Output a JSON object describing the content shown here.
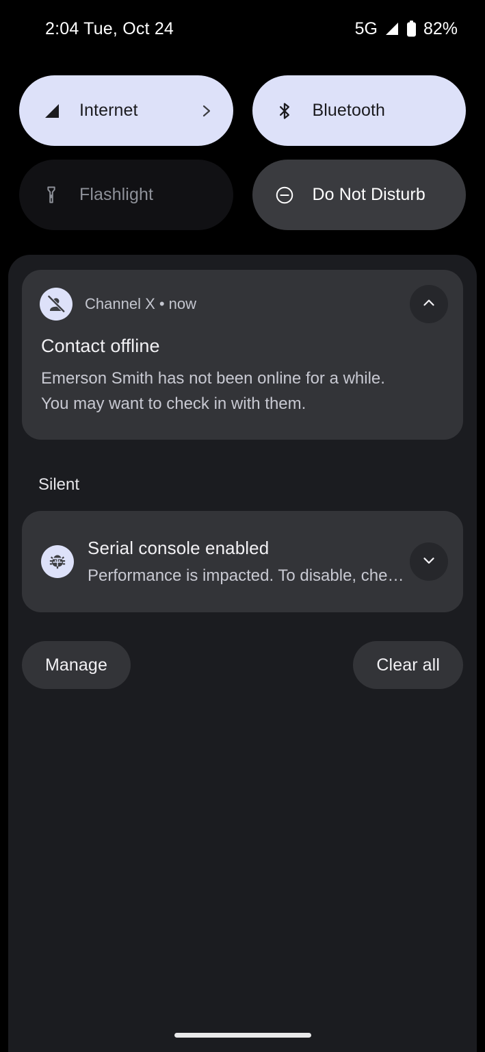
{
  "status_bar": {
    "time_date": "2:04 Tue, Oct 24",
    "network_type": "5G",
    "signal_icon": "signal-bars-icon",
    "battery_icon": "battery-icon",
    "battery_percent": "82%"
  },
  "quick_settings": {
    "tiles": [
      {
        "label": "Internet",
        "icon": "signal-bars-icon",
        "state": "active",
        "chevron": "chevron-right-icon"
      },
      {
        "label": "Bluetooth",
        "icon": "bluetooth-icon",
        "state": "active"
      },
      {
        "label": "Flashlight",
        "icon": "flashlight-icon",
        "state": "inactive-dark"
      },
      {
        "label": "Do Not Disturb",
        "icon": "do-not-disturb-icon",
        "state": "inactive-gray"
      }
    ]
  },
  "shade": {
    "notifications": [
      {
        "app_icon": "person-off-icon",
        "meta": "Channel X • now",
        "title": "Contact offline",
        "body": "Emerson Smith has not been online for a while. You may want to check in with them.",
        "expand_icon": "chevron-up-icon"
      }
    ],
    "silent_section": {
      "label": "Silent",
      "notifications": [
        {
          "app_icon": "bug-icon",
          "title": "Serial console enabled",
          "body": "Performance is impacted. To disable, che…",
          "expand_icon": "chevron-down-icon"
        }
      ]
    },
    "actions": {
      "manage_label": "Manage",
      "clear_all_label": "Clear all"
    }
  },
  "navigation": {
    "home_handle": "home-gesture-bar"
  },
  "colors": {
    "screen_background": "#000000",
    "shade_background": "#1b1c20",
    "card_background": "#333438",
    "tile_active_background": "#dde1f9",
    "tile_inactive_background": "#3a3b3f",
    "tile_disabled_background": "#111114",
    "accent_icon_background": "#dde1f9",
    "primary_text": "#f2f1f4",
    "secondary_text": "#c8c9d2"
  }
}
